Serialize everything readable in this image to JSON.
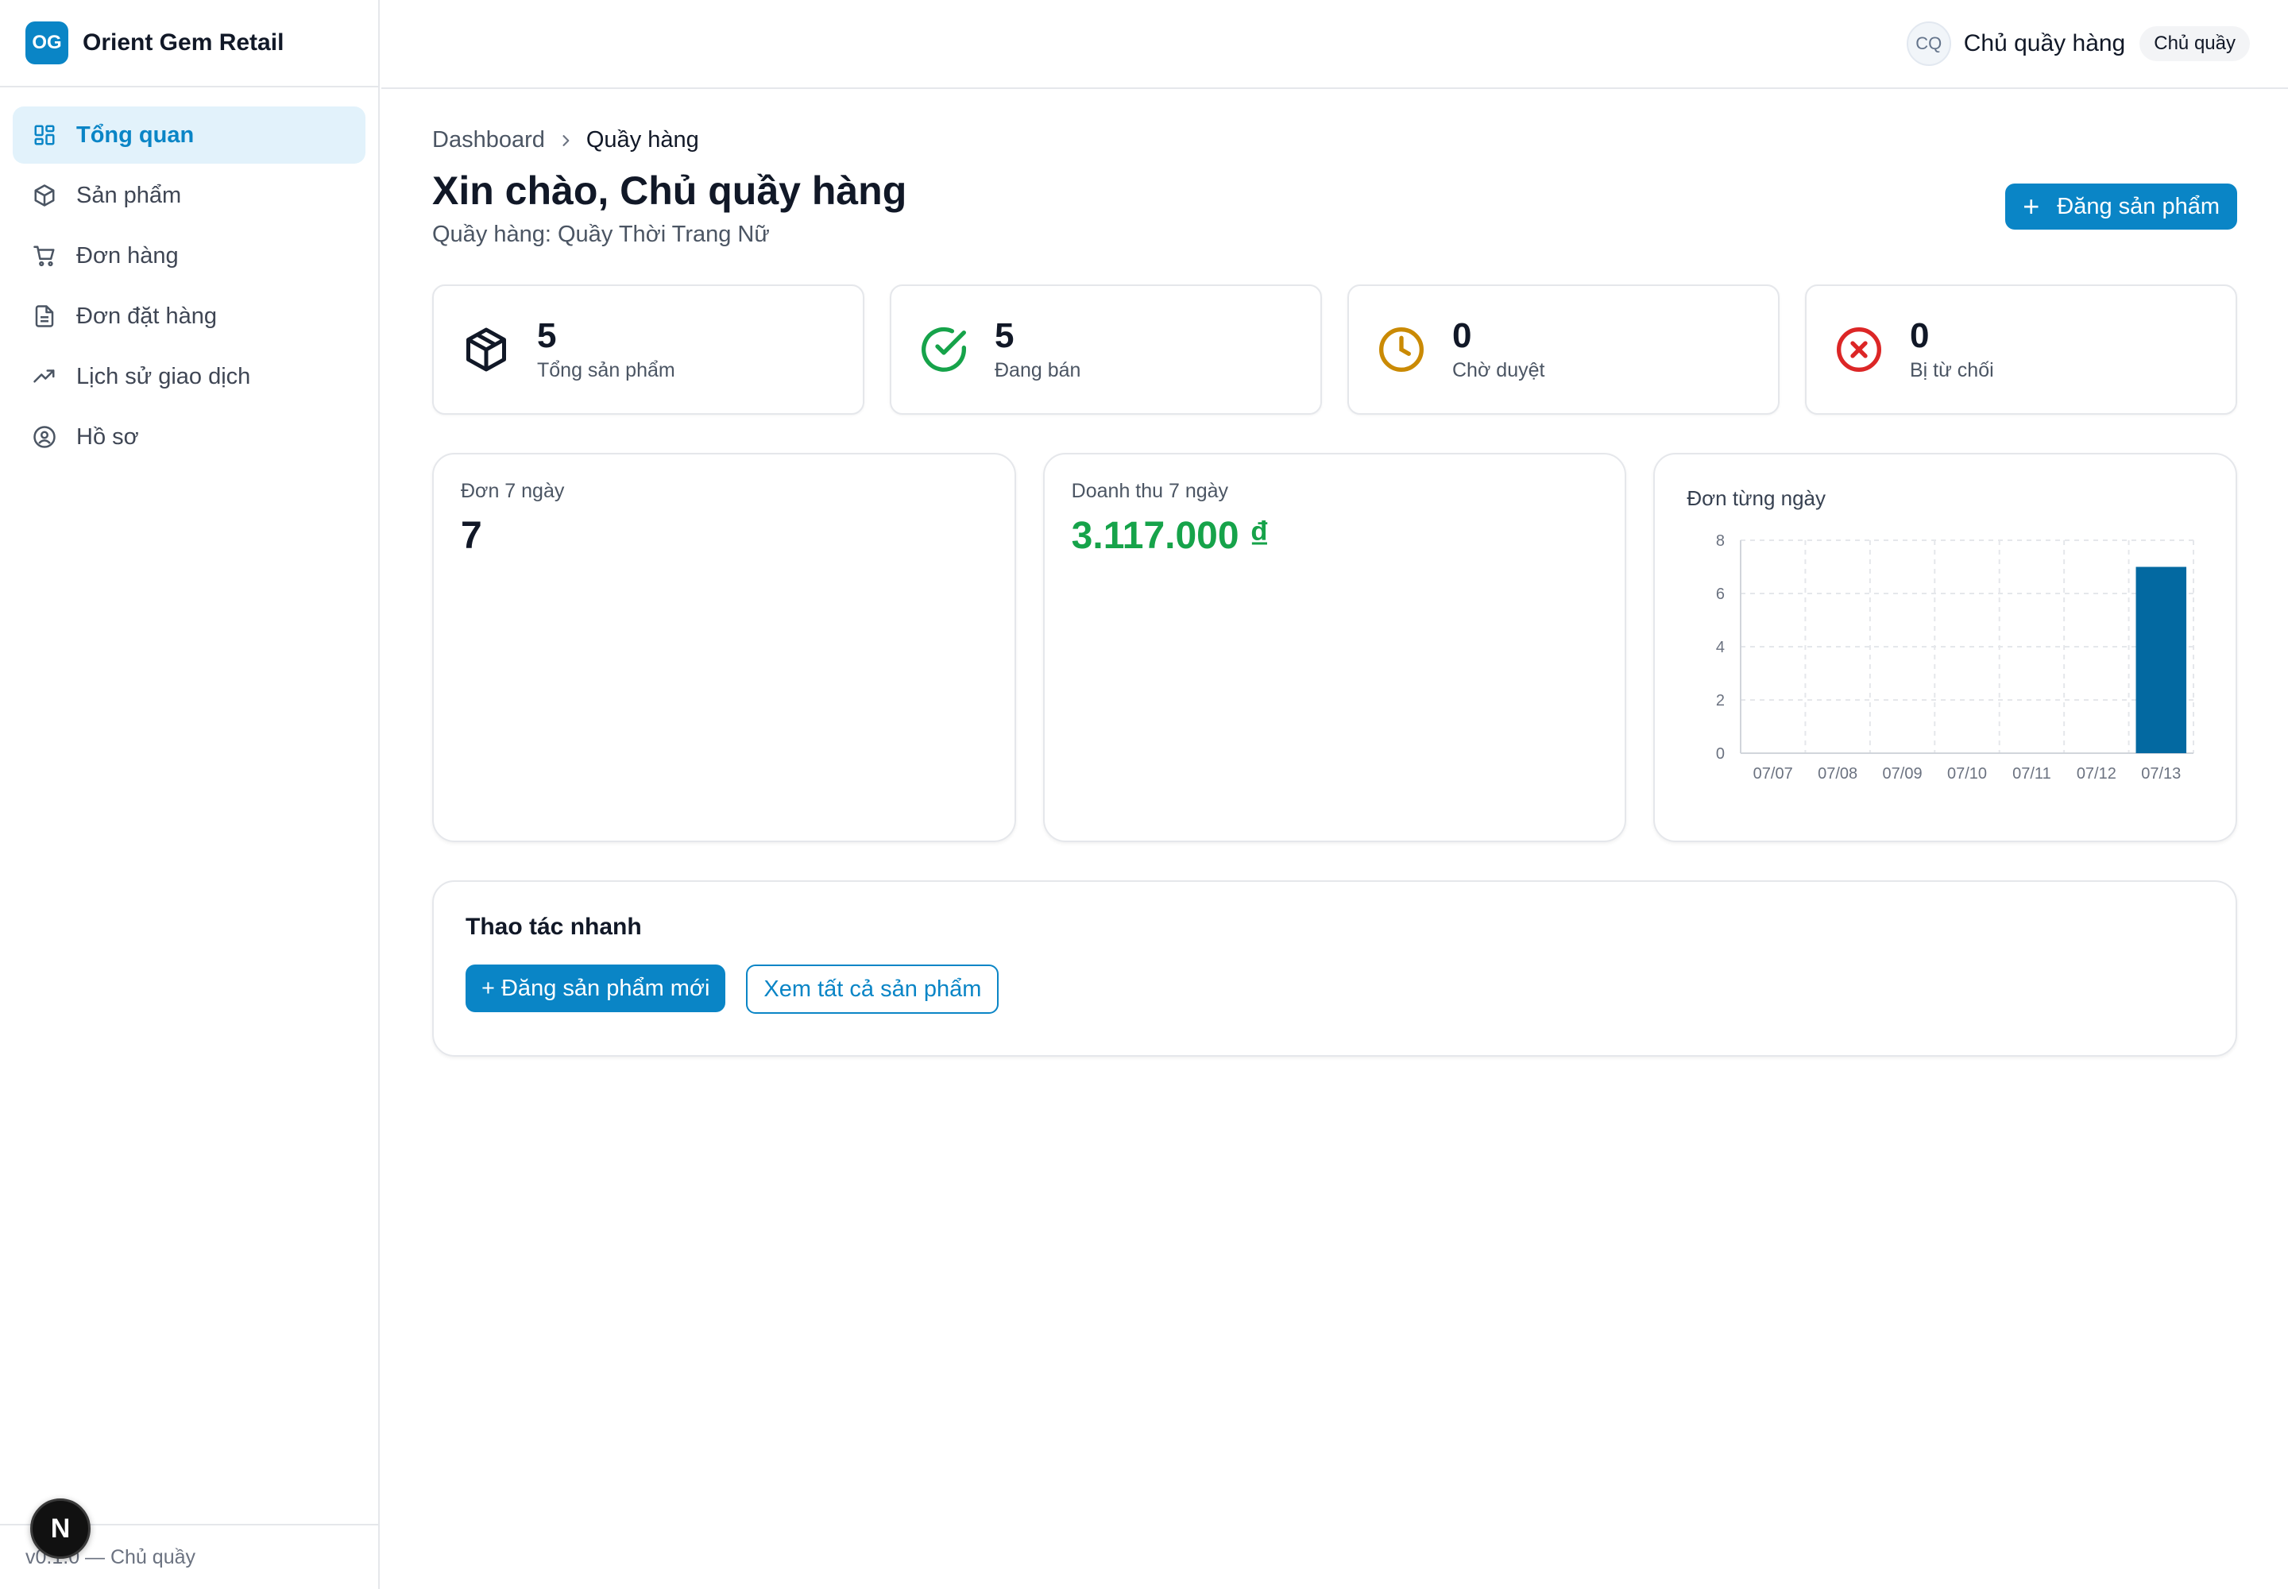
{
  "brand": {
    "logo_text": "OG",
    "name": "Orient Gem Retail"
  },
  "sidebar": {
    "items": [
      {
        "label": "Tổng quan",
        "icon": "dashboard-grid-icon",
        "active": true
      },
      {
        "label": "Sản phẩm",
        "icon": "box-icon",
        "active": false
      },
      {
        "label": "Đơn hàng",
        "icon": "cart-icon",
        "active": false
      },
      {
        "label": "Đơn đặt hàng",
        "icon": "document-icon",
        "active": false
      },
      {
        "label": "Lịch sử giao dịch",
        "icon": "trending-up-icon",
        "active": false
      },
      {
        "label": "Hồ sơ",
        "icon": "user-circle-icon",
        "active": false
      }
    ],
    "footer": "v0.1.0 — Chủ quầy"
  },
  "next_badge": "N",
  "header": {
    "avatar": "CQ",
    "user_name": "Chủ quầy hàng",
    "role": "Chủ quầy"
  },
  "breadcrumb": {
    "root": "Dashboard",
    "current": "Quầy hàng"
  },
  "page": {
    "title": "Xin chào, Chủ quầy hàng",
    "subtitle": "Quầy hàng: Quầy Thời Trang Nữ",
    "primary_button": "Đăng sản phẩm"
  },
  "stats": [
    {
      "value": "5",
      "label": "Tổng sản phẩm",
      "icon": "box-icon",
      "color": "#111827"
    },
    {
      "value": "5",
      "label": "Đang bán",
      "icon": "check-circle-icon",
      "color": "#16a34a"
    },
    {
      "value": "0",
      "label": "Chờ duyệt",
      "icon": "clock-icon",
      "color": "#ca8a04"
    },
    {
      "value": "0",
      "label": "Bị từ chối",
      "icon": "x-circle-icon",
      "color": "#dc2626"
    }
  ],
  "panels": {
    "orders": {
      "label": "Đơn 7 ngày",
      "value": "7"
    },
    "revenue": {
      "label": "Doanh thu 7 ngày",
      "value": "3.117.000 ₫",
      "color": "#16a34a"
    },
    "chart": {
      "title": "Đơn từng ngày"
    }
  },
  "chart_data": {
    "type": "bar",
    "title": "Đơn từng ngày",
    "categories": [
      "07/07",
      "07/08",
      "07/09",
      "07/10",
      "07/11",
      "07/12",
      "07/13"
    ],
    "values": [
      0,
      0,
      0,
      0,
      0,
      0,
      7
    ],
    "ylim": [
      0,
      8
    ],
    "yticks": [
      0,
      2,
      4,
      6,
      8
    ],
    "grid": true,
    "bar_color": "#0369a1"
  },
  "quick": {
    "title": "Thao tác nhanh",
    "primary": "+ Đăng sản phẩm mới",
    "secondary": "Xem tất cả sản phẩm"
  }
}
